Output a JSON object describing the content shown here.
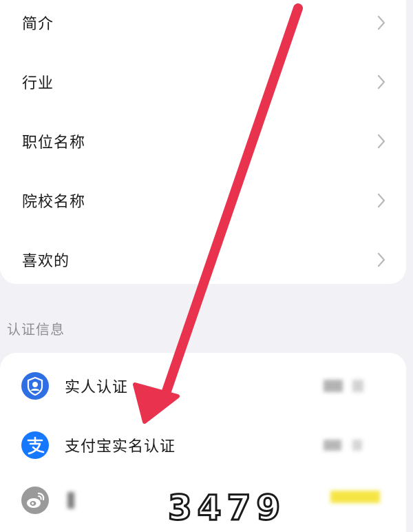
{
  "profile_items": [
    {
      "label": "简介"
    },
    {
      "label": "行业"
    },
    {
      "label": "职位名称"
    },
    {
      "label": "院校名称"
    },
    {
      "label": "喜欢的"
    }
  ],
  "auth_section": {
    "title": "认证信息",
    "items": [
      {
        "label": "实人认证",
        "icon": "person-verify-icon"
      },
      {
        "label": "支付宝实名认证",
        "icon": "alipay-icon"
      },
      {
        "label": "",
        "icon": "weibo-icon"
      }
    ]
  },
  "watermark": {
    "text": "3479"
  },
  "colors": {
    "arrow": "#e8324e",
    "alipay_blue": "#1677ff",
    "person_blue": "#2f6fe4",
    "weibo_gray": "#9a9a9a",
    "chevron": "#b8b8bd",
    "section_text": "#8e8e93",
    "highlight_yellow": "#f5e43a"
  }
}
